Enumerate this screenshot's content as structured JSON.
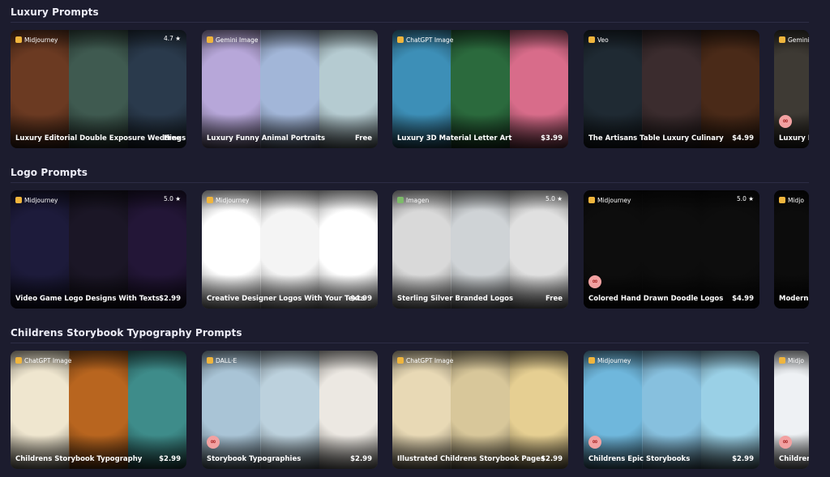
{
  "sections": [
    {
      "title": "Luxury Prompts",
      "cards": [
        {
          "model": "Midjourney",
          "model_color": "#f0b53d",
          "rating": "4.7 ★",
          "title": "Luxury Editorial Double Exposure Weddings",
          "price": "Free",
          "loop": false,
          "panels": [
            "#6b3a22",
            "#3f5a50",
            "#2a3a4c"
          ]
        },
        {
          "model": "Gemini Image",
          "model_color": "#f0b53d",
          "rating": "",
          "title": "Luxury Funny Animal Portraits",
          "price": "Free",
          "loop": false,
          "panels": [
            "#b7a7d9",
            "#a2b6d8",
            "#b5cbd1"
          ]
        },
        {
          "model": "ChatGPT Image",
          "model_color": "#f0b53d",
          "rating": "",
          "title": "Luxury 3D Material Letter Art",
          "price": "$3.99",
          "loop": false,
          "panels": [
            "#3d8fb7",
            "#2b6a3d",
            "#d86c8a"
          ]
        },
        {
          "model": "Veo",
          "model_color": "#f0b53d",
          "rating": "",
          "title": "The Artisans Table Luxury Culinary",
          "price": "$4.99",
          "loop": false,
          "panels": [
            "#1f2a33",
            "#3b2c2e",
            "#4a2a18"
          ]
        },
        {
          "model": "Gemini",
          "model_color": "#f0b53d",
          "rating": "",
          "title": "Luxury Ba",
          "price": "",
          "loop": true,
          "panels": [
            "#3e3a34"
          ]
        }
      ]
    },
    {
      "title": "Logo Prompts",
      "cards": [
        {
          "model": "Midjourney",
          "model_color": "#f0b53d",
          "rating": "5.0 ★",
          "title": "Video Game Logo Designs With Texts",
          "price": "$2.99",
          "loop": false,
          "panels": [
            "#1d1b3b",
            "#1b1626",
            "#231637"
          ]
        },
        {
          "model": "Midjourney",
          "model_color": "#f0b53d",
          "rating": "",
          "title": "Creative Designer Logos With Your Texts",
          "price": "$4.99",
          "loop": false,
          "panels": [
            "#ffffff",
            "#f4f4f4",
            "#ffffff"
          ]
        },
        {
          "model": "Imagen",
          "model_color": "#7dbb6a",
          "rating": "5.0 ★",
          "title": "Sterling Silver Branded Logos",
          "price": "Free",
          "loop": false,
          "panels": [
            "#d9d9d9",
            "#cfd3d6",
            "#e0e0e0"
          ]
        },
        {
          "model": "Midjourney",
          "model_color": "#f0b53d",
          "rating": "5.0 ★",
          "title": "Colored Hand Drawn Doodle Logos",
          "price": "$4.99",
          "loop": true,
          "panels": [
            "#0d0d0d",
            "#0d0d0d",
            "#0d0d0d"
          ]
        },
        {
          "model": "Midjo",
          "model_color": "#f0b53d",
          "rating": "",
          "title": "Modern C",
          "price": "",
          "loop": false,
          "panels": [
            "#0c0c0c"
          ]
        }
      ]
    },
    {
      "title": "Childrens Storybook Typography Prompts",
      "cards": [
        {
          "model": "ChatGPT Image",
          "model_color": "#f0b53d",
          "rating": "",
          "title": "Childrens Storybook Typography",
          "price": "$2.99",
          "loop": false,
          "panels": [
            "#efe6cf",
            "#b8651f",
            "#3e8c8a"
          ]
        },
        {
          "model": "DALL·E",
          "model_color": "#f0b53d",
          "rating": "",
          "title": "Storybook Typographies",
          "price": "$2.99",
          "loop": true,
          "panels": [
            "#a9c4d6",
            "#bcd1dd",
            "#ece8e2"
          ]
        },
        {
          "model": "ChatGPT Image",
          "model_color": "#f0b53d",
          "rating": "",
          "title": "Illustrated Childrens Storybook Pages",
          "price": "$2.99",
          "loop": false,
          "panels": [
            "#e8d9b5",
            "#d8c79a",
            "#e6cf92"
          ]
        },
        {
          "model": "Midjourney",
          "model_color": "#f0b53d",
          "rating": "",
          "title": "Childrens Epic Storybooks",
          "price": "$2.99",
          "loop": true,
          "panels": [
            "#6fb7dc",
            "#87c0de",
            "#9ad0e6"
          ]
        },
        {
          "model": "Midjo",
          "model_color": "#f0b53d",
          "rating": "",
          "title": "Childrens",
          "price": "",
          "loop": true,
          "panels": [
            "#eef1f4"
          ]
        }
      ]
    }
  ]
}
